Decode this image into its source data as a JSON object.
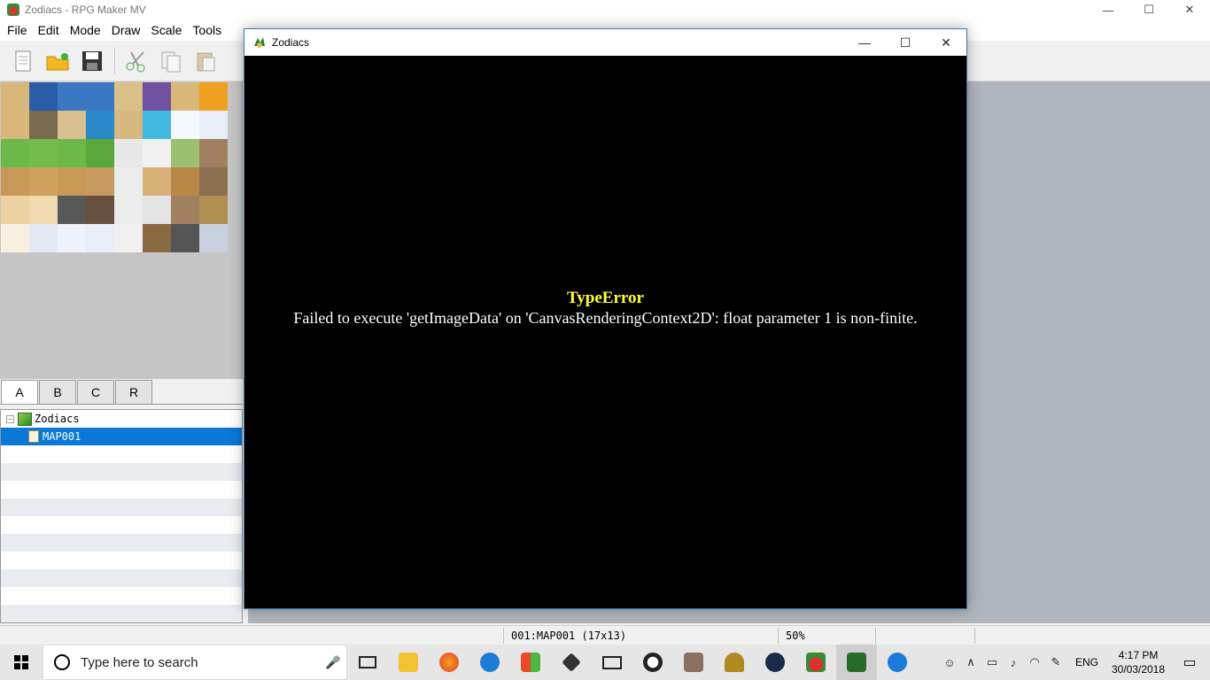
{
  "app": {
    "title": "Zodiacs - RPG Maker MV",
    "window_controls": [
      "—",
      "☐",
      "✕"
    ]
  },
  "menu": [
    "File",
    "Edit",
    "Mode",
    "Draw",
    "Scale",
    "Tools"
  ],
  "tabs": [
    "A",
    "B",
    "C",
    "R"
  ],
  "tree": {
    "project": "Zodiacs",
    "map": "MAP001"
  },
  "status": {
    "map_info": "001:MAP001 (17x13)",
    "zoom": "50%"
  },
  "game": {
    "title": "Zodiacs",
    "error_title": "TypeError",
    "error_message": "Failed to execute 'getImageData' on 'CanvasRenderingContext2D': float parameter 1 is non-finite.",
    "window_controls": [
      "—",
      "☐",
      "✕"
    ]
  },
  "taskbar": {
    "search_placeholder": "Type here to search",
    "language": "ENG",
    "time": "4:17 PM",
    "date": "30/03/2018"
  },
  "colors": {
    "selection": "#0a78d7",
    "error_title": "#ffff33",
    "map_bg": "#b0b5bd"
  }
}
